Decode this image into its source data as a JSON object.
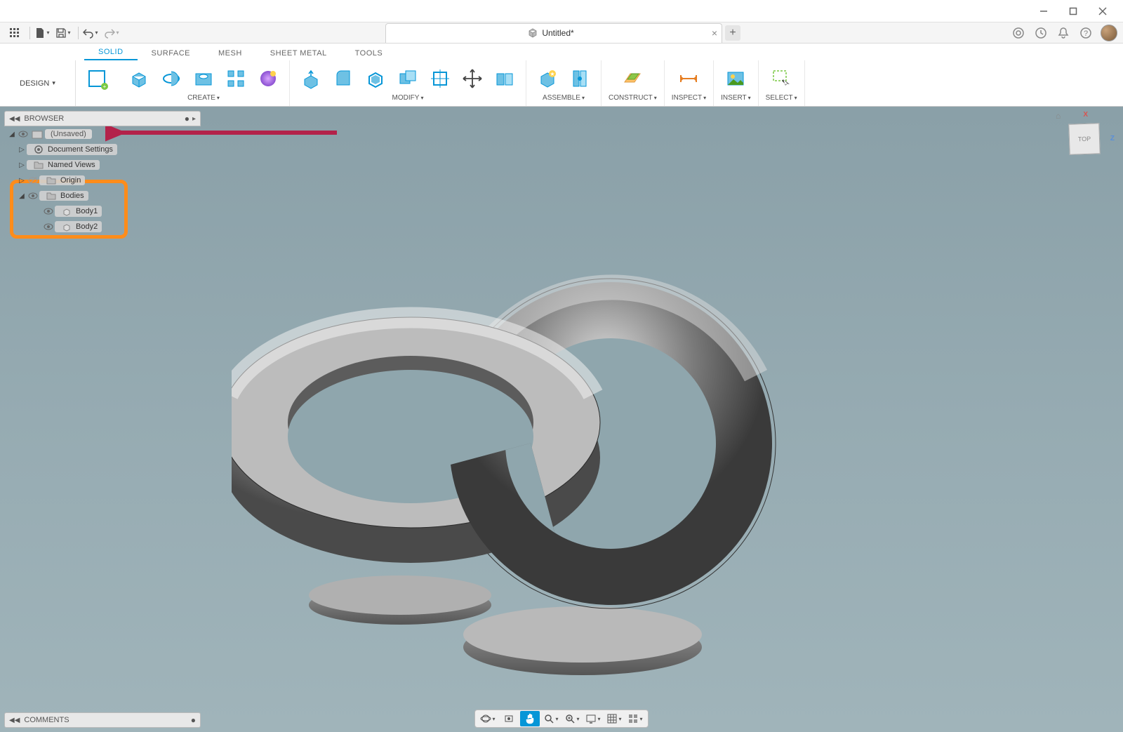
{
  "window": {
    "minimize_title": "Minimize",
    "maximize_title": "Maximize",
    "close_title": "Close"
  },
  "quickaccess": {
    "apps_title": "Show Data Panel",
    "file_title": "File",
    "save_title": "Save",
    "undo_title": "Undo",
    "redo_title": "Redo"
  },
  "document": {
    "title": "Untitled*",
    "close_tab": "×",
    "add_tab": "+"
  },
  "status_icons": {
    "extensions": "Extensions",
    "job_status": "Job Status",
    "notifications": "Notifications",
    "help": "Help",
    "profile": "Profile"
  },
  "workspace": {
    "label": "DESIGN"
  },
  "ribbon_tabs": [
    "SOLID",
    "SURFACE",
    "MESH",
    "SHEET METAL",
    "TOOLS"
  ],
  "ribbon_active_index": 0,
  "toolbar_groups": [
    {
      "label": "CREATE",
      "dropdown": true,
      "icons": [
        "sketch",
        "box",
        "revolve",
        "hole",
        "pattern",
        "texture"
      ]
    },
    {
      "label": "MODIFY",
      "dropdown": true,
      "icons": [
        "presspull",
        "fillet",
        "shell",
        "combine",
        "align",
        "move",
        "split"
      ]
    },
    {
      "label": "ASSEMBLE",
      "dropdown": true,
      "icons": [
        "component",
        "joint"
      ]
    },
    {
      "label": "CONSTRUCT",
      "dropdown": true,
      "icons": [
        "plane"
      ]
    },
    {
      "label": "INSPECT",
      "dropdown": true,
      "icons": [
        "measure"
      ]
    },
    {
      "label": "INSERT",
      "dropdown": true,
      "icons": [
        "decal"
      ]
    },
    {
      "label": "SELECT",
      "dropdown": true,
      "icons": [
        "select-box"
      ]
    }
  ],
  "browser": {
    "title": "BROWSER",
    "root": "(Unsaved)",
    "items": [
      {
        "label": "Document Settings",
        "icon": "gear",
        "expanded": false,
        "indent": 1
      },
      {
        "label": "Named Views",
        "icon": "folder",
        "expanded": false,
        "indent": 1
      },
      {
        "label": "Origin",
        "icon": "folder",
        "expanded": false,
        "indent": 1,
        "has_eye": true
      },
      {
        "label": "Bodies",
        "icon": "folder",
        "expanded": true,
        "indent": 1,
        "has_eye": true
      },
      {
        "label": "Body1",
        "icon": "body",
        "indent": 3,
        "has_eye": true
      },
      {
        "label": "Body2",
        "icon": "body",
        "indent": 3,
        "has_eye": true
      }
    ]
  },
  "comments": {
    "title": "COMMENTS"
  },
  "navbar": {
    "buttons": [
      "orbit",
      "look",
      "pan",
      "zoom",
      "fit",
      "display",
      "grid",
      "viewports"
    ],
    "active_index": 2
  },
  "viewcube": {
    "face": "TOP",
    "axes": {
      "x": "X",
      "z": "Z"
    }
  },
  "annotations": {
    "arrow_target": "browser-root",
    "highlight_target": "bodies-section"
  }
}
